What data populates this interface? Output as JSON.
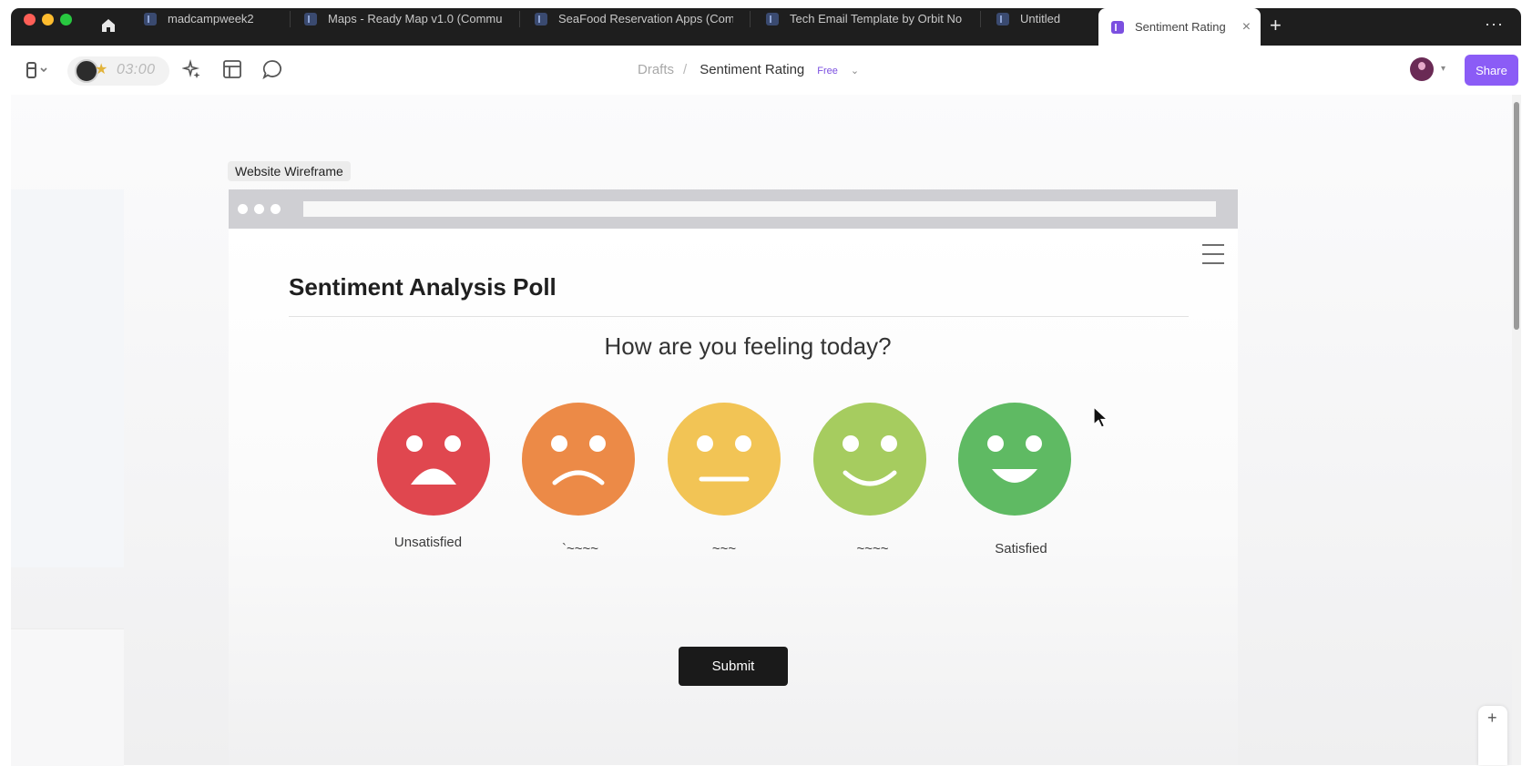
{
  "browser": {
    "traffic_lights": [
      {
        "name": "close",
        "color": "#ff5f57"
      },
      {
        "name": "minimize",
        "color": "#febc2e"
      },
      {
        "name": "maximize",
        "color": "#28c840"
      }
    ],
    "tabs": [
      {
        "label": "madcampweek2",
        "active": false
      },
      {
        "label": "Maps - Ready Map v1.0 (Commu",
        "active": false
      },
      {
        "label": "SeaFood Reservation Apps (Com",
        "active": false
      },
      {
        "label": "Tech Email Template by Orbit No",
        "active": false
      },
      {
        "label": "Untitled",
        "active": false
      },
      {
        "label": "Sentiment Rating",
        "active": true
      }
    ],
    "close_glyph": "×",
    "new_tab_glyph": "+",
    "more_glyph": "···"
  },
  "toolbar": {
    "timer": "03:00",
    "breadcrumb": {
      "parent": "Drafts",
      "separator": "/",
      "current": "Sentiment Rating",
      "badge": "Free"
    },
    "share_label": "Share",
    "icons": [
      "frame-menu-icon",
      "sparkle-ai-icon",
      "layout-panel-icon",
      "comment-bubble-icon"
    ]
  },
  "canvas": {
    "frame_label": "Website Wireframe",
    "page": {
      "title": "Sentiment Analysis Poll",
      "question": "How are you feeling today?",
      "faces": [
        {
          "name": "very-unhappy",
          "color": "#e0474f",
          "label": "Unsatisfied"
        },
        {
          "name": "unhappy",
          "color": "#ec8a47",
          "label": "`~~~~"
        },
        {
          "name": "neutral",
          "color": "#f2c455",
          "label": "~~~"
        },
        {
          "name": "happy",
          "color": "#a6cc5f",
          "label": "~~~~"
        },
        {
          "name": "very-happy",
          "color": "#5fba63",
          "label": "Satisfied"
        }
      ],
      "submit_label": "Submit"
    },
    "zoom_in_glyph": "+"
  },
  "colors": {
    "accent": "#8b5cf6",
    "tab_bar": "#1e1e1e",
    "submit": "#1a1a1a"
  }
}
